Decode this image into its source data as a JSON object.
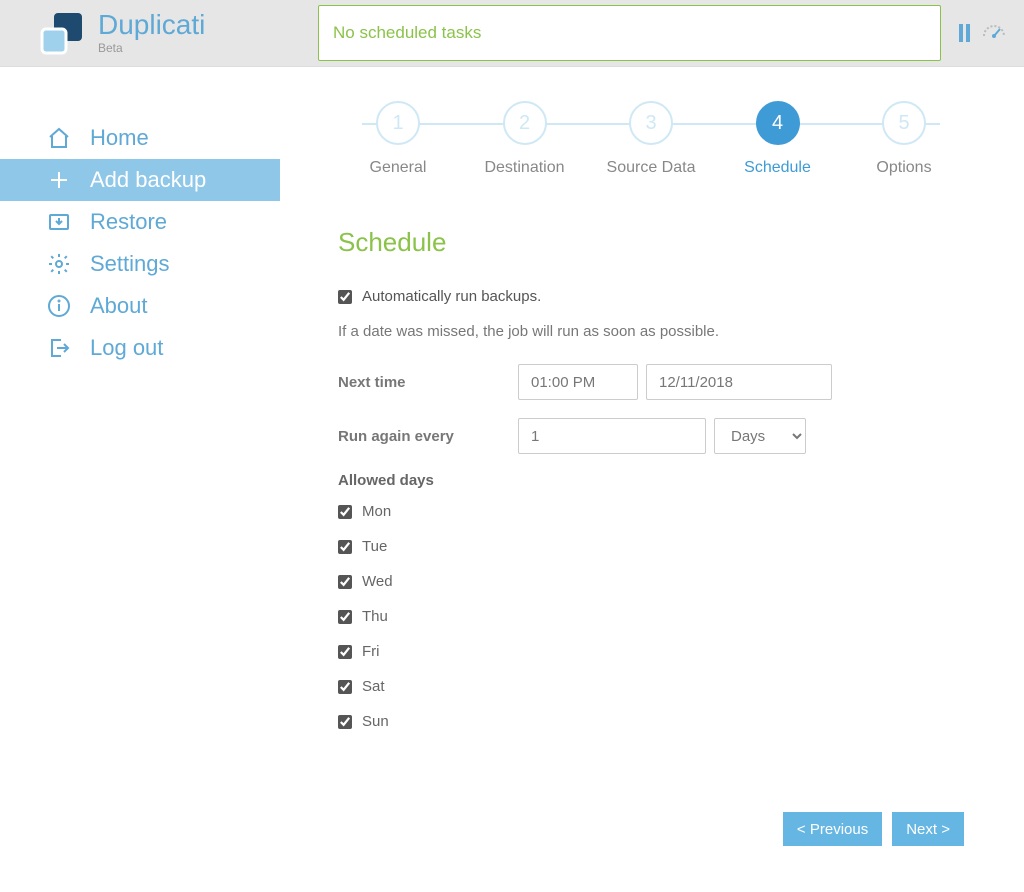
{
  "app": {
    "title": "Duplicati",
    "subtitle": "Beta",
    "status": "No scheduled tasks"
  },
  "nav": {
    "home": "Home",
    "add_backup": "Add backup",
    "restore": "Restore",
    "settings": "Settings",
    "about": "About",
    "logout": "Log out"
  },
  "steps": [
    {
      "num": "1",
      "label": "General"
    },
    {
      "num": "2",
      "label": "Destination"
    },
    {
      "num": "3",
      "label": "Source Data"
    },
    {
      "num": "4",
      "label": "Schedule"
    },
    {
      "num": "5",
      "label": "Options"
    }
  ],
  "schedule": {
    "heading": "Schedule",
    "auto_run_label": "Automatically run backups.",
    "auto_run_checked": true,
    "hint": "If a date was missed, the job will run as soon as possible.",
    "next_time_label": "Next time",
    "next_time_value": "01:00 PM",
    "next_date_value": "12/11/2018",
    "run_again_label": "Run again every",
    "run_again_value": "1",
    "run_again_unit": "Days",
    "allowed_days_label": "Allowed days",
    "days": [
      {
        "label": "Mon",
        "checked": true
      },
      {
        "label": "Tue",
        "checked": true
      },
      {
        "label": "Wed",
        "checked": true
      },
      {
        "label": "Thu",
        "checked": true
      },
      {
        "label": "Fri",
        "checked": true
      },
      {
        "label": "Sat",
        "checked": true
      },
      {
        "label": "Sun",
        "checked": true
      }
    ]
  },
  "buttons": {
    "prev": "< Previous",
    "next": "Next >"
  }
}
